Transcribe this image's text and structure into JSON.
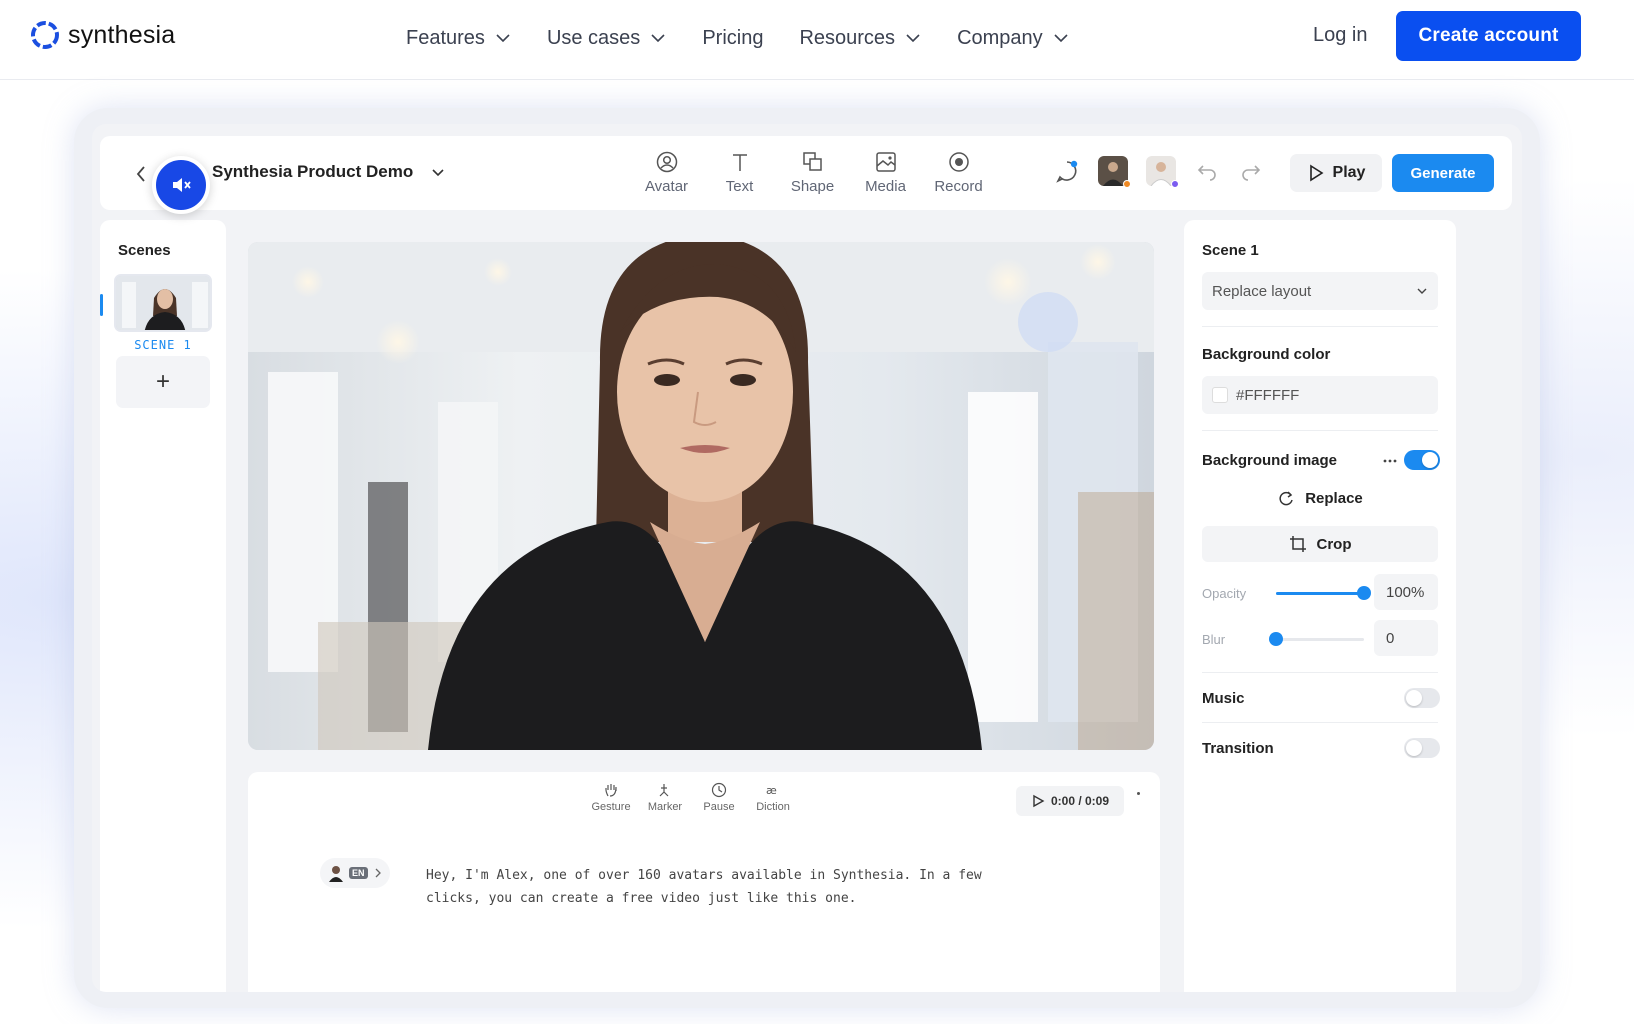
{
  "nav": {
    "logo_text": "synthesia",
    "links": [
      "Features",
      "Use cases",
      "Pricing",
      "Resources",
      "Company"
    ],
    "login": "Log in",
    "create_account": "Create account",
    "brand_color": "#0a4ff0"
  },
  "editor": {
    "project_title": "Synthesia Product Demo",
    "tools": [
      "Avatar",
      "Text",
      "Shape",
      "Media",
      "Record"
    ],
    "play_label": "Play",
    "generate_label": "Generate",
    "accent_color": "#1b8af0"
  },
  "scenes": {
    "title": "Scenes",
    "items": [
      {
        "label": "SCENE 1"
      }
    ],
    "add_label": "+"
  },
  "script": {
    "tools": [
      "Gesture",
      "Marker",
      "Pause",
      "Diction"
    ],
    "time": "0:00 / 0:09",
    "language": "EN",
    "text": "Hey, I'm Alex, one of over 160 avatars available in Synthesia. In a few clicks, you can create a free video just like this one."
  },
  "properties": {
    "scene_title": "Scene 1",
    "layout_select": "Replace layout",
    "background_color_label": "Background color",
    "background_color_value": "#FFFFFF",
    "background_image_label": "Background image",
    "background_image_enabled": true,
    "replace_label": "Replace",
    "crop_label": "Crop",
    "opacity_label": "Opacity",
    "opacity_value": "100%",
    "opacity_level": 1.0,
    "blur_label": "Blur",
    "blur_value": "0",
    "blur_level": 0,
    "music_label": "Music",
    "music_enabled": false,
    "transition_label": "Transition",
    "transition_enabled": false
  }
}
